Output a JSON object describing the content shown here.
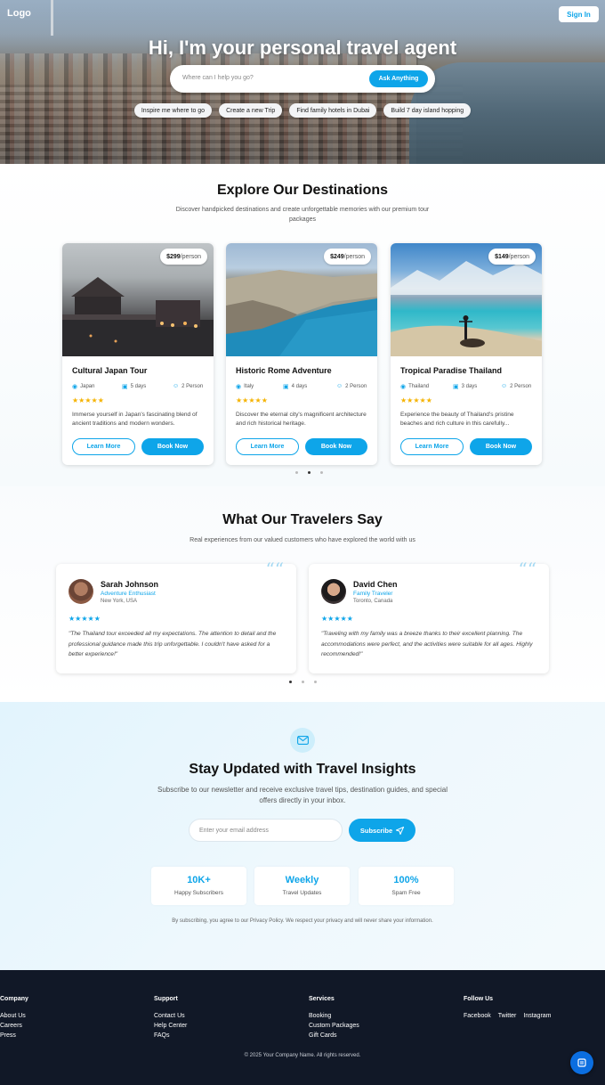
{
  "header": {
    "logo": "Logo",
    "signin_label": "Sign In"
  },
  "hero": {
    "title": "Hi, I'm your personal travel agent",
    "search_placeholder": "Where can I help you go?",
    "ask_label": "Ask Anything",
    "suggestions": [
      "Inspire me where to go",
      "Create a new Trip",
      "Find family hotels in Dubai",
      "Build 7 day island hopping"
    ]
  },
  "destinations": {
    "title": "Explore Our Destinations",
    "subtitle": "Discover handpicked destinations and create unforgettable memories with our premium tour packages",
    "cards": [
      {
        "price": "$299",
        "per": "/person",
        "title": "Cultural Japan Tour",
        "location": "Japan",
        "duration": "5 days",
        "people": "2 Person",
        "stars": "★★★★★",
        "description": "Immerse yourself in Japan's fascinating blend of ancient traditions and modern wonders.",
        "learn_label": "Learn More",
        "book_label": "Book Now"
      },
      {
        "price": "$249",
        "per": "/person",
        "title": "Historic Rome Adventure",
        "location": "Italy",
        "duration": "4 days",
        "people": "2 Person",
        "stars": "★★★★★",
        "description": "Discover the eternal city's magnificent architecture and rich historical heritage.",
        "learn_label": "Learn More",
        "book_label": "Book Now"
      },
      {
        "price": "$149",
        "per": "/person",
        "title": "Tropical Paradise Thailand",
        "location": "Thailand",
        "duration": "3 days",
        "people": "2 Person",
        "stars": "★★★★★",
        "description": "Experience the beauty of Thailand's pristine beaches and rich culture in this carefully...",
        "learn_label": "Learn More",
        "book_label": "Book Now"
      }
    ],
    "carousel_active": 2,
    "carousel_count": 3
  },
  "testimonials": {
    "title": "What Our Travelers Say",
    "subtitle": "Real experiences from our valued customers who have explored the world with us",
    "items": [
      {
        "name": "Sarah Johnson",
        "role": "Adventure Enthusiast",
        "location": "New York, USA",
        "stars": "★★★★★",
        "quote": "\"The Thailand tour exceeded all my expectations. The attention to detail and the professional guidance made this trip unforgettable. I couldn't have asked for a better experience!\""
      },
      {
        "name": "David Chen",
        "role": "Family Traveler",
        "location": "Toronto, Canada",
        "stars": "★★★★★",
        "quote": "\"Traveling with my family was a breeze thanks to their excellent planning. The accommodations were perfect, and the activities were suitable for all ages. Highly recommended!\""
      }
    ],
    "carousel_active": 1,
    "carousel_count": 3
  },
  "newsletter": {
    "title": "Stay Updated with Travel Insights",
    "subtitle": "Subscribe to our newsletter and receive exclusive travel tips, destination guides, and special offers directly in your inbox.",
    "email_placeholder": "Enter your email address",
    "subscribe_label": "Subscribe",
    "stats": [
      {
        "value": "10K+",
        "label": "Happy Subscribers"
      },
      {
        "value": "Weekly",
        "label": "Travel Updates"
      },
      {
        "value": "100%",
        "label": "Spam Free"
      }
    ],
    "privacy": "By subscribing, you agree to our Privacy Policy. We respect your privacy and will never share your information."
  },
  "footer": {
    "columns": [
      {
        "title": "Company",
        "links": [
          "About Us",
          "Careers",
          "Press"
        ]
      },
      {
        "title": "Support",
        "links": [
          "Contact Us",
          "Help Center",
          "FAQs"
        ]
      },
      {
        "title": "Services",
        "links": [
          "Booking",
          "Custom Packages",
          "Gift Cards"
        ]
      }
    ],
    "follow": {
      "title": "Follow Us",
      "links": [
        "Facebook",
        "Twitter",
        "Instagram"
      ]
    },
    "copyright": "© 2025 Your Company Name. All rights reserved."
  },
  "colors": {
    "accent": "#0ea5e9",
    "footer_bg": "#111827",
    "star": "#f5b300"
  }
}
